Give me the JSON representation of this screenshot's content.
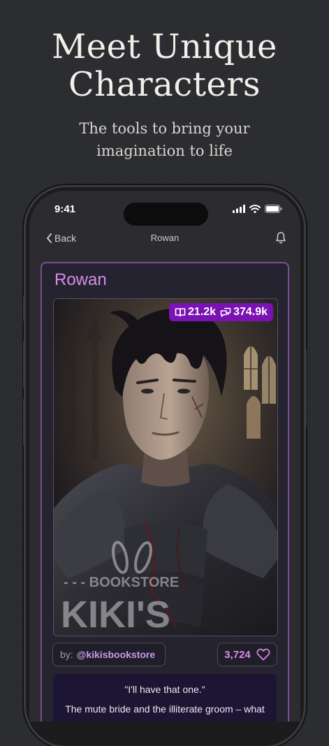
{
  "hero": {
    "title_line1": "Meet Unique",
    "title_line2": "Characters",
    "subtitle_line1": "The tools to bring your",
    "subtitle_line2": "imagination to life"
  },
  "status_bar": {
    "time": "9:41"
  },
  "nav": {
    "back_label": "Back",
    "title": "Rowan",
    "icons": [
      "chevron-left-icon",
      "bell-icon"
    ]
  },
  "character": {
    "name": "Rowan",
    "reads": "21.2k",
    "chats": "374.9k",
    "watermark_top": "- - - BOOKSTORE",
    "watermark_main": "KIKI'S",
    "author_prefix": "by:",
    "author_handle": "@kikisbookstore",
    "likes": "3,724",
    "quote": "\"I'll have that one.\"",
    "description": "The mute bride and the illiterate groom – what"
  },
  "colors": {
    "accent": "#d98be8",
    "badge": "#7b12b3",
    "card_border": "#7a4f96",
    "background": "#2b2c2f"
  }
}
